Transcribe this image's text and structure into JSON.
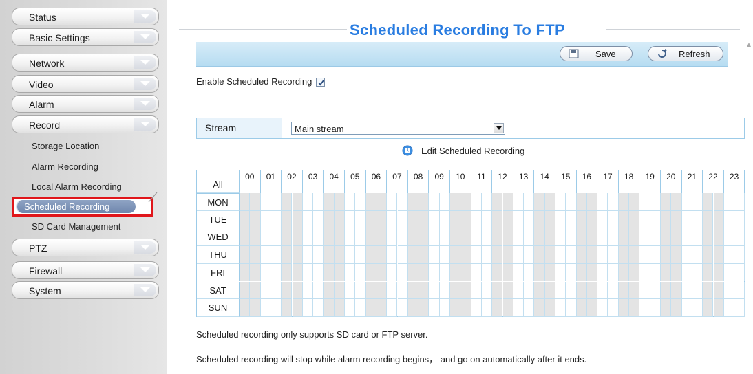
{
  "sidebar": {
    "menu": [
      {
        "label": "Status",
        "name": "status"
      },
      {
        "label": "Basic Settings",
        "name": "basic-settings"
      },
      {
        "label": "Network",
        "name": "network"
      },
      {
        "label": "Video",
        "name": "video"
      },
      {
        "label": "Alarm",
        "name": "alarm"
      },
      {
        "label": "Record",
        "name": "record"
      },
      {
        "label": "PTZ",
        "name": "ptz"
      },
      {
        "label": "Firewall",
        "name": "firewall"
      },
      {
        "label": "System",
        "name": "system"
      }
    ],
    "record_submenu": [
      {
        "label": "Storage Location"
      },
      {
        "label": "Alarm Recording"
      },
      {
        "label": "Local Alarm Recording"
      },
      {
        "label": "Scheduled Recording",
        "active": true
      },
      {
        "label": "SD Card Management"
      }
    ]
  },
  "main": {
    "title": "Scheduled Recording To FTP",
    "toolbar": {
      "save_label": "Save",
      "refresh_label": "Refresh"
    },
    "enable": {
      "label": "Enable Scheduled Recording",
      "checked": true
    },
    "stream": {
      "label": "Stream",
      "value": "Main stream"
    },
    "edit_link": "Edit Scheduled Recording",
    "schedule": {
      "all_label": "All",
      "hours": [
        "00",
        "01",
        "02",
        "03",
        "04",
        "05",
        "06",
        "07",
        "08",
        "09",
        "10",
        "11",
        "12",
        "13",
        "14",
        "15",
        "16",
        "17",
        "18",
        "19",
        "20",
        "21",
        "22",
        "23"
      ],
      "days": [
        "MON",
        "TUE",
        "WED",
        "THU",
        "FRI",
        "SAT",
        "SUN"
      ]
    },
    "notes": [
      "Scheduled recording only supports SD card or FTP server.",
      "Scheduled recording will stop while alarm recording begins， and go on automatically after it ends."
    ]
  },
  "colors": {
    "title_blue": "#2a7de1",
    "toolbar_blue": "#b6dcf1",
    "active_highlight": "#e0161b",
    "active_pill": "#6f86ad"
  }
}
